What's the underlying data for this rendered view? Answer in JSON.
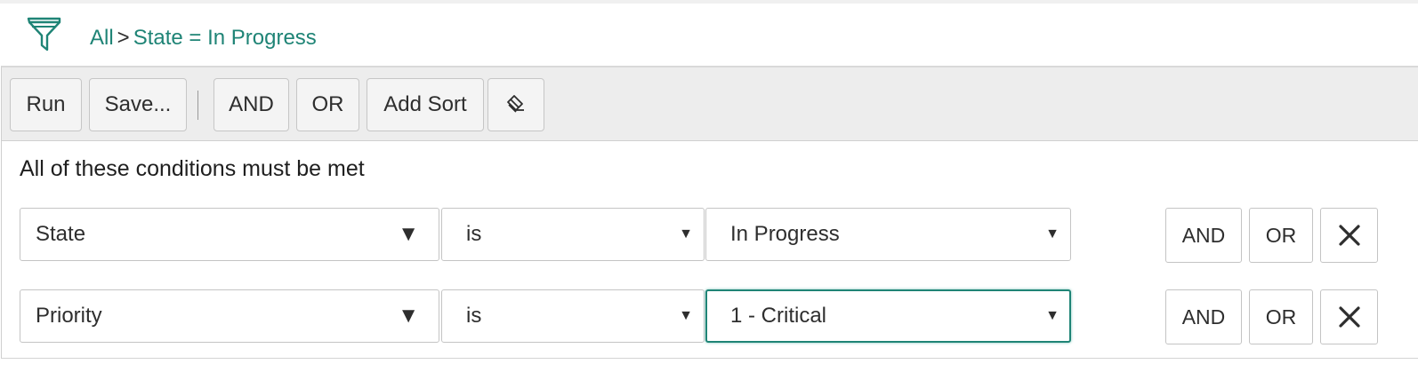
{
  "breadcrumb": {
    "root": "All",
    "separator": ">",
    "condition": "State = In Progress"
  },
  "icons": {
    "filter": "filter-funnel-icon",
    "clear": "eraser-icon",
    "remove": "close-icon",
    "dropdown": "triangle-down-icon"
  },
  "toolbar": {
    "run": "Run",
    "save": "Save...",
    "and": "AND",
    "or": "OR",
    "add_sort": "Add Sort"
  },
  "heading": "All of these conditions must be met",
  "conditions": [
    {
      "field": "State",
      "operator": "is",
      "value": "In Progress",
      "and": "AND",
      "or": "OR"
    },
    {
      "field": "Priority",
      "operator": "is",
      "value": "1 - Critical",
      "and": "AND",
      "or": "OR"
    }
  ],
  "colors": {
    "accent": "#1f8476",
    "toolbar_bg": "#ededed"
  }
}
